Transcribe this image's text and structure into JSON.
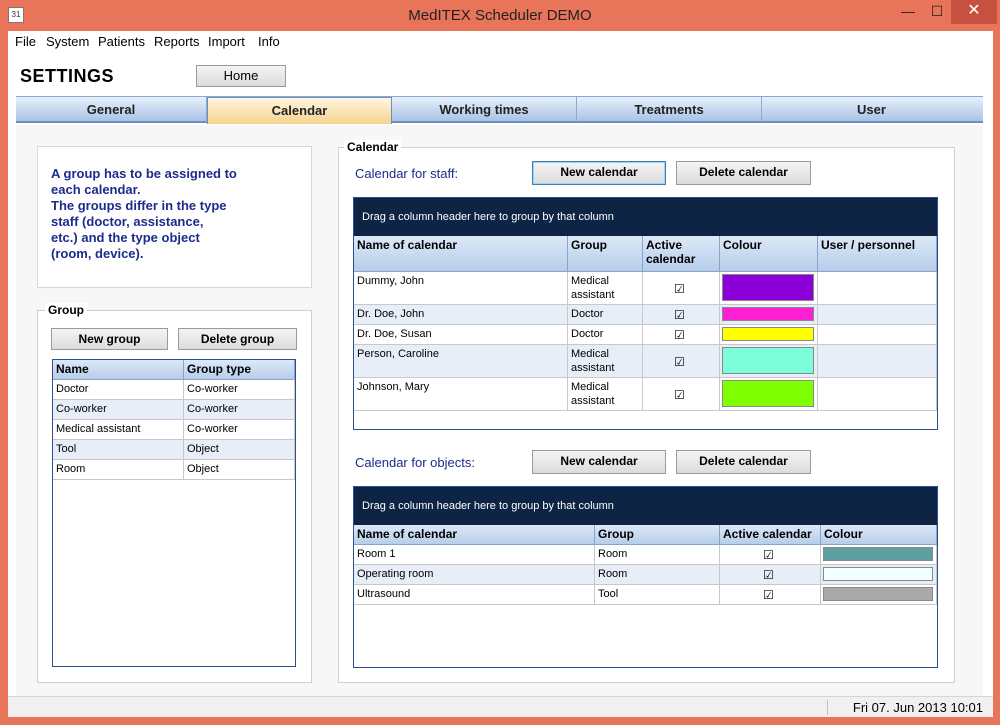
{
  "window": {
    "title": "MedITEX  Scheduler DEMO",
    "icon_label": "31",
    "min_symbol": "—",
    "max_symbol": "☐",
    "close_symbol": "✕"
  },
  "menu": [
    "File",
    "System",
    "Patients",
    "Reports",
    "Import",
    "Info"
  ],
  "settings_title": "SETTINGS",
  "home_button": "Home",
  "tabs": [
    "General",
    "Calendar",
    "Working times",
    "Treatments",
    "User"
  ],
  "info_text": "A group has to be assigned to\neach calendar.\nThe groups differ in the type\nstaff (doctor, assistance,\netc.) and the type object\n(room, device).",
  "group": {
    "label": "Group",
    "new_button": "New group",
    "delete_button": "Delete group",
    "columns": [
      "Name",
      "Group type"
    ],
    "rows": [
      [
        "Doctor",
        "Co-worker"
      ],
      [
        "Co-worker",
        "Co-worker"
      ],
      [
        "Medical assistant",
        "Co-worker"
      ],
      [
        "Tool",
        "Object"
      ],
      [
        "Room",
        "Object"
      ]
    ]
  },
  "calendar": {
    "label": "Calendar",
    "staff": {
      "label": "Calendar for staff:",
      "new_button": "New calendar",
      "delete_button": "Delete calendar",
      "groupbar": "Drag a column header here to group by that column",
      "columns": [
        "Name of calendar",
        "Group",
        "Active calendar",
        "Colour",
        "User / personnel"
      ],
      "rows": [
        {
          "name": "Dummy, John",
          "group": "Medical assistant",
          "active": true,
          "colour": "#8b00d6",
          "user": ""
        },
        {
          "name": "Dr. Doe, John",
          "group": "Doctor",
          "active": true,
          "colour": "#ff1fd2",
          "user": ""
        },
        {
          "name": "Dr. Doe, Susan",
          "group": "Doctor",
          "active": true,
          "colour": "#ffff00",
          "user": ""
        },
        {
          "name": "Person, Caroline",
          "group": "Medical assistant",
          "active": true,
          "colour": "#7cffd9",
          "user": ""
        },
        {
          "name": "Johnson, Mary",
          "group": "Medical assistant",
          "active": true,
          "colour": "#80ff00",
          "user": ""
        }
      ]
    },
    "objects": {
      "label": "Calendar for objects:",
      "new_button": "New calendar",
      "delete_button": "Delete calendar",
      "groupbar": "Drag a column header here to group by that column",
      "columns": [
        "Name of calendar",
        "Group",
        "Active calendar",
        "Colour"
      ],
      "rows": [
        {
          "name": "Room 1",
          "group": "Room",
          "active": true,
          "colour": "#5f9ea0"
        },
        {
          "name": "Operating room",
          "group": "Room",
          "active": true,
          "colour": "#f0ffff"
        },
        {
          "name": "Ultrasound",
          "group": "Tool",
          "active": true,
          "colour": "#a9a9a9"
        }
      ]
    }
  },
  "status": {
    "datetime": "Fri 07. Jun 2013 10:01"
  },
  "check_glyph": "☑"
}
